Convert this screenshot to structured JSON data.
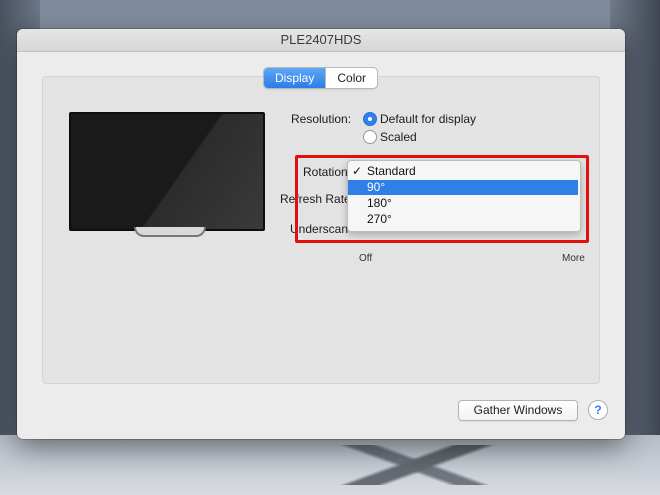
{
  "window": {
    "title": "PLE2407HDS"
  },
  "tabs": [
    {
      "label": "Display",
      "active": true
    },
    {
      "label": "Color",
      "active": false
    }
  ],
  "resolution": {
    "label": "Resolution:",
    "options": [
      {
        "label": "Default for display",
        "selected": true
      },
      {
        "label": "Scaled",
        "selected": false
      }
    ]
  },
  "rotation": {
    "label": "Rotation",
    "check_mark": "✓",
    "items": [
      "Standard",
      "90°",
      "180°",
      "270°"
    ],
    "checked_index": 0,
    "highlighted_index": 1
  },
  "refresh_rate": {
    "label": "Refresh Rate"
  },
  "underscan": {
    "label": "Underscan",
    "min_label": "Off",
    "max_label": "More"
  },
  "footer": {
    "gather_windows_label": "Gather Windows",
    "help_label": "?"
  },
  "colors": {
    "accent": "#2f7fe8",
    "highlight_box": "#e01010"
  }
}
